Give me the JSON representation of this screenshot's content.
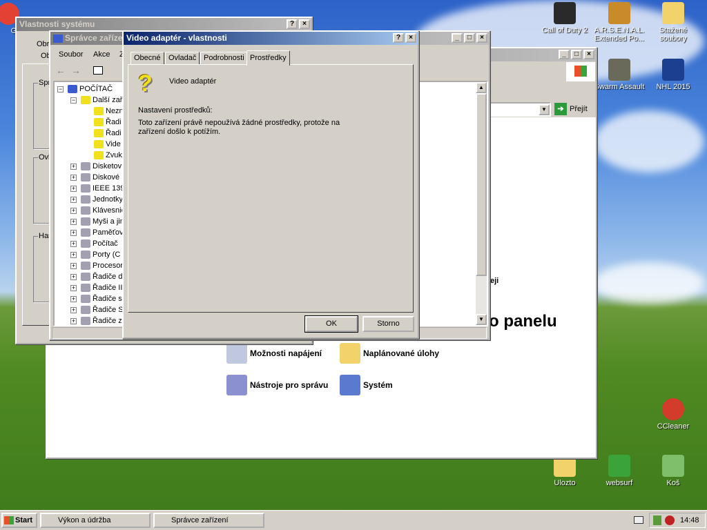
{
  "desktop": {
    "icons": [
      {
        "label": "Goo",
        "color": "#e34133"
      },
      {
        "label": "Call of Duty 2",
        "color": "#2a2a2a"
      },
      {
        "label": "A.R.S.E.N.A.L. Extended Po...",
        "color": "#c98a2a"
      },
      {
        "label": "Stažené soubory",
        "color": "#f2d36b"
      },
      {
        "label": "Swarm Assault",
        "color": "#6a6a5a"
      },
      {
        "label": "NHL 2015",
        "color": "#1c3f8f"
      },
      {
        "label": "CCleaner",
        "color": "#d33b2a"
      },
      {
        "label": "Ulozto",
        "color": "#f2d36b"
      },
      {
        "label": "websurf",
        "color": "#3aa33a"
      },
      {
        "label": "Koš",
        "color": "#7fbf6a"
      }
    ]
  },
  "control_panel": {
    "go_label": "Přejít",
    "partial_text": "eji",
    "heading": "o panelu",
    "items": [
      {
        "label": "Možnosti napájení"
      },
      {
        "label": "Naplánované úlohy"
      },
      {
        "label": "Nástroje pro správu"
      },
      {
        "label": "Systém"
      }
    ]
  },
  "system_props": {
    "title": "Vlastnosti systému",
    "help": "?",
    "close": "×",
    "tabs": [
      "Obr",
      "Ob"
    ],
    "groups": [
      "Spr",
      "Ovl",
      "Har"
    ]
  },
  "device_manager": {
    "title": "Správce zaříze",
    "menu": [
      "Soubor",
      "Akce",
      "Z"
    ],
    "tree": [
      {
        "label": "POČÍTAČ",
        "level": 0,
        "pm": "−"
      },
      {
        "label": "Další zař",
        "level": 1,
        "pm": "−",
        "warn": true
      },
      {
        "label": "Nezn",
        "level": 2,
        "warn": true
      },
      {
        "label": "Řadi",
        "level": 2,
        "warn": true
      },
      {
        "label": "Řadi",
        "level": 2,
        "warn": true
      },
      {
        "label": "Vide",
        "level": 2,
        "warn": true
      },
      {
        "label": "Zvuk",
        "level": 2,
        "warn": true
      },
      {
        "label": "Disketov",
        "level": 1,
        "pm": "+"
      },
      {
        "label": "Diskové",
        "level": 1,
        "pm": "+"
      },
      {
        "label": "IEEE 139",
        "level": 1,
        "pm": "+"
      },
      {
        "label": "Jednotky",
        "level": 1,
        "pm": "+"
      },
      {
        "label": "Klávesnic",
        "level": 1,
        "pm": "+"
      },
      {
        "label": "Myši a jin",
        "level": 1,
        "pm": "+"
      },
      {
        "label": "Paměťov",
        "level": 1,
        "pm": "+"
      },
      {
        "label": "Počítač",
        "level": 1,
        "pm": "+"
      },
      {
        "label": "Porty (C",
        "level": 1,
        "pm": "+"
      },
      {
        "label": "Procesor",
        "level": 1,
        "pm": "+"
      },
      {
        "label": "Řadiče d",
        "level": 1,
        "pm": "+"
      },
      {
        "label": "Řadiče II",
        "level": 1,
        "pm": "+"
      },
      {
        "label": "Řadiče s",
        "level": 1,
        "pm": "+"
      },
      {
        "label": "Řadiče S",
        "level": 1,
        "pm": "+"
      },
      {
        "label": "Řadiče z",
        "level": 1,
        "pm": "+"
      }
    ]
  },
  "dialog": {
    "title": "Video adaptér - vlastnosti",
    "help": "?",
    "close": "×",
    "tabs": [
      "Obecné",
      "Ovladač",
      "Podrobnosti",
      "Prostředky"
    ],
    "selected_tab": "Prostředky",
    "device_name": "Video adaptér",
    "section_label": "Nastavení prostředků:",
    "message_line1": "Toto zařízení právě nepoužívá žádné prostředky, protože na",
    "message_line2": "zařízení došlo k potížím.",
    "ok": "OK",
    "cancel": "Storno"
  },
  "taskbar": {
    "start": "Start",
    "tasks": [
      "Výkon a údržba",
      "Správce zařízení"
    ],
    "clock": "14:48"
  }
}
